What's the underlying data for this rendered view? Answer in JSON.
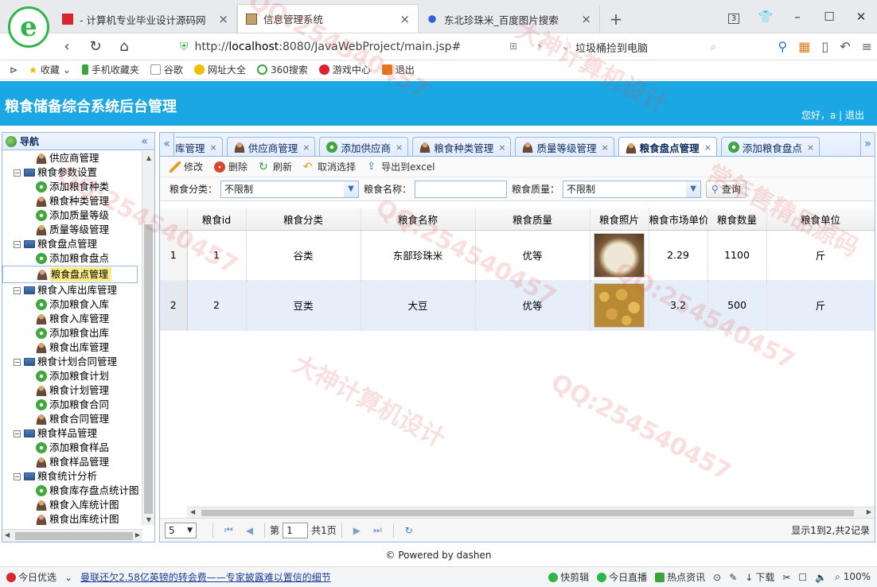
{
  "browser": {
    "tabs": [
      {
        "label": "- 计算机专业毕业设计源码网",
        "active": false
      },
      {
        "label": "信息管理系统",
        "active": true
      },
      {
        "label": "东北珍珠米_百度图片搜索",
        "active": false
      }
    ],
    "new_tab": "+",
    "tab_count": "3",
    "url_prefix": "http://",
    "url_host": "localhost",
    "url_rest": ":8080/JavaWebProject/main.jsp#",
    "search_text": "垃圾桶捡到电脑",
    "bookmarks": [
      "收藏",
      "手机收藏夹",
      "谷歌",
      "网址大全",
      "360搜索",
      "游戏中心",
      "退出"
    ]
  },
  "app": {
    "title": "粮食储备综合系统后台管理",
    "greeting": "您好，a",
    "sep": " | ",
    "logout": "退出",
    "nav_title": "导航",
    "collapse": "«",
    "tree": [
      {
        "label": "供应商管理",
        "level": 2,
        "icon": "person"
      },
      {
        "label": "粮食参数设置",
        "level": 1,
        "icon": "pc"
      },
      {
        "label": "添加粮食种类",
        "level": 2,
        "icon": "add"
      },
      {
        "label": "粮食种类管理",
        "level": 2,
        "icon": "person"
      },
      {
        "label": "添加质量等级",
        "level": 2,
        "icon": "add"
      },
      {
        "label": "质量等级管理",
        "level": 2,
        "icon": "person"
      },
      {
        "label": "粮食盘点管理",
        "level": 1,
        "icon": "pc"
      },
      {
        "label": "添加粮食盘点",
        "level": 2,
        "icon": "add"
      },
      {
        "label": "粮食盘点管理",
        "level": 2,
        "icon": "person",
        "selected": true
      },
      {
        "label": "粮食入库出库管理",
        "level": 1,
        "icon": "pc"
      },
      {
        "label": "添加粮食入库",
        "level": 2,
        "icon": "add"
      },
      {
        "label": "粮食入库管理",
        "level": 2,
        "icon": "person"
      },
      {
        "label": "添加粮食出库",
        "level": 2,
        "icon": "add"
      },
      {
        "label": "粮食出库管理",
        "level": 2,
        "icon": "person"
      },
      {
        "label": "粮食计划合同管理",
        "level": 1,
        "icon": "pc"
      },
      {
        "label": "添加粮食计划",
        "level": 2,
        "icon": "add"
      },
      {
        "label": "粮食计划管理",
        "level": 2,
        "icon": "person"
      },
      {
        "label": "添加粮食合同",
        "level": 2,
        "icon": "add"
      },
      {
        "label": "粮食合同管理",
        "level": 2,
        "icon": "person"
      },
      {
        "label": "粮食样品管理",
        "level": 1,
        "icon": "pc"
      },
      {
        "label": "添加粮食样品",
        "level": 2,
        "icon": "add"
      },
      {
        "label": "粮食样品管理",
        "level": 2,
        "icon": "person"
      },
      {
        "label": "粮食统计分析",
        "level": 1,
        "icon": "pc"
      },
      {
        "label": "粮食库存盘点统计图",
        "level": 2,
        "icon": "add"
      },
      {
        "label": "粮食入库统计图",
        "level": 2,
        "icon": "person"
      },
      {
        "label": "粮食出库统计图",
        "level": 2,
        "icon": "person"
      }
    ],
    "panel_tabs": [
      {
        "label": "库管理",
        "icon": "",
        "active": false
      },
      {
        "label": "供应商管理",
        "icon": "person",
        "active": false
      },
      {
        "label": "添加供应商",
        "icon": "add",
        "active": false
      },
      {
        "label": "粮食种类管理",
        "icon": "person",
        "active": false
      },
      {
        "label": "质量等级管理",
        "icon": "person",
        "active": false
      },
      {
        "label": "粮食盘点管理",
        "icon": "person",
        "active": true
      },
      {
        "label": "添加粮食盘点",
        "icon": "add",
        "active": false
      }
    ],
    "toolbar": {
      "edit": "修改",
      "delete": "删除",
      "refresh": "刷新",
      "cancel_select": "取消选择",
      "export": "导出到excel"
    },
    "filters": {
      "category_label": "粮食分类：",
      "category_value": "不限制",
      "name_label": "粮食名称：",
      "name_value": "",
      "quality_label": "粮食质量：",
      "quality_value": "不限制",
      "query": "查询"
    },
    "grid": {
      "columns": [
        "粮食id",
        "粮食分类",
        "粮食名称",
        "粮食质量",
        "粮食照片",
        "粮食市场单价",
        "粮食数量",
        "粮食单位"
      ],
      "rows": [
        {
          "rn": "1",
          "id": "1",
          "category": "谷类",
          "name": "东部珍珠米",
          "quality": "优等",
          "photo": "rice",
          "price": "2.29",
          "qty": "1100",
          "unit": "斤"
        },
        {
          "rn": "2",
          "id": "2",
          "category": "豆类",
          "name": "大豆",
          "quality": "优等",
          "photo": "soybean",
          "price": "3.2",
          "qty": "500",
          "unit": "斤"
        }
      ]
    },
    "pager": {
      "page_size": "5",
      "page_prefix": "第",
      "page": "1",
      "page_total": "共1页",
      "info": "显示1到2,共2记录"
    },
    "footer": "© Powered by dashen"
  },
  "statusbar": {
    "today": "今日优选",
    "news": "曼联还欠2.58亿英镑的转会费——专家披露难以置信的细节",
    "items": [
      "快剪辑",
      "今日直播",
      "热点资讯",
      "下载"
    ],
    "zoom": "100%"
  },
  "watermarks": [
    "QQ:254540457",
    "大神计算机设计",
    "常年售精品源码"
  ]
}
